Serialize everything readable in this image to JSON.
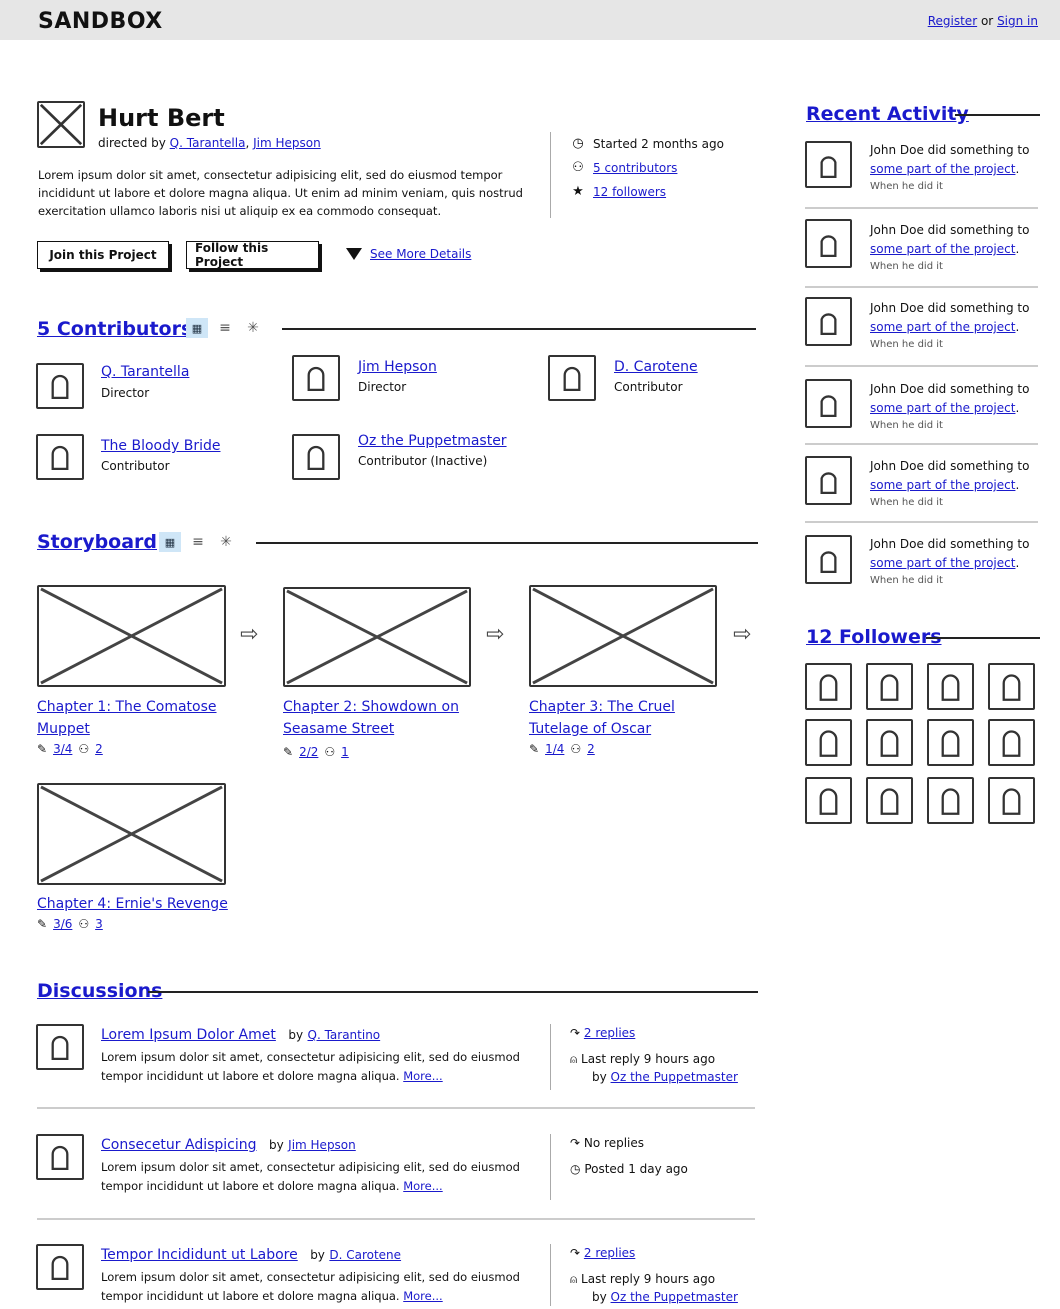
{
  "app": {
    "brand": "SANDBOX",
    "register": "Register",
    "or": "or",
    "sign_in": "Sign in"
  },
  "project": {
    "title": "Hurt Bert",
    "directed_prefix": "directed by",
    "directors": [
      "Q. Tarantella",
      "Jim Hepson"
    ],
    "description": "Lorem ipsum dolor sit amet, consectetur adipisicing elit, sed do eiusmod tempor incididunt ut labore et dolore magna aliqua. Ut enim ad minim veniam, quis nostrud exercitation ullamco laboris nisi ut aliquip ex ea commodo consequat.",
    "started": "Started 2 months ago",
    "contributors_link": "5 contributors",
    "followers_link": "12 followers",
    "join_label": "Join this Project",
    "follow_label": "Follow this Project",
    "details_label": "See More Details"
  },
  "contributors": {
    "heading": "5 Contributors",
    "people": [
      {
        "name": "Q. Tarantella",
        "role": "Director"
      },
      {
        "name": "Jim Hepson",
        "role": "Director"
      },
      {
        "name": "D. Carotene",
        "role": "Contributor"
      },
      {
        "name": "The Bloody Bride",
        "role": "Contributor"
      },
      {
        "name": "Oz the Puppetmaster",
        "role": "Contributor (Inactive)"
      }
    ]
  },
  "storyboard": {
    "heading": "Storyboard",
    "chapters": [
      {
        "title": "Chapter 1: The Comatose Muppet",
        "scenes": "3/4",
        "people": "2"
      },
      {
        "title": "Chapter 2: Showdown on Seasame Street",
        "scenes": "2/2",
        "people": "1"
      },
      {
        "title": "Chapter 3: The Cruel Tutelage of Oscar",
        "scenes": "1/4",
        "people": "2"
      },
      {
        "title": "Chapter 4: Ernie's Revenge",
        "scenes": "3/6",
        "people": "3"
      }
    ]
  },
  "discussions": {
    "heading": "Discussions",
    "items": [
      {
        "title": "Lorem Ipsum Dolor Amet",
        "by": "by",
        "author": "Q. Tarantino",
        "text": "Lorem ipsum dolor sit amet, consectetur adipisicing elit, sed do eiusmod tempor incididunt ut labore et dolore magna aliqua.",
        "more": "More...",
        "replies": "2 replies",
        "status": "Last reply 9 hours ago",
        "last_by": "by",
        "last_author": "Oz the Puppetmaster"
      },
      {
        "title": "Consecetur Adispicing",
        "by": "by",
        "author": "Jim Hepson",
        "text": "Lorem ipsum dolor sit amet, consectetur adipisicing elit, sed do eiusmod tempor incididunt ut labore et dolore magna aliqua.",
        "more": "More...",
        "replies": "No replies",
        "status": "Posted 1 day ago",
        "last_by": "",
        "last_author": ""
      },
      {
        "title": "Tempor Incididunt ut Labore",
        "by": "by",
        "author": "D. Carotene",
        "text": "Lorem ipsum dolor sit amet, consectetur adipisicing elit, sed do eiusmod tempor incididunt ut labore et dolore magna aliqua.",
        "more": "More...",
        "replies": "2 replies",
        "status": "Last reply 9 hours ago",
        "last_by": "by",
        "last_author": "Oz the Puppetmaster"
      }
    ]
  },
  "activity": {
    "heading": "Recent Activity",
    "items": [
      {
        "actor": "John Doe did something to",
        "target": "some part of the project",
        "when": "When he did it"
      },
      {
        "actor": "John Doe did something to",
        "target": "some part of the project",
        "when": "When he did it"
      },
      {
        "actor": "John Doe did something to",
        "target": "some part of the project",
        "when": "When he did it"
      },
      {
        "actor": "John Doe did something to",
        "target": "some part of the project",
        "when": "When he did it"
      },
      {
        "actor": "John Doe did something to",
        "target": "some part of the project",
        "when": "When he did it"
      },
      {
        "actor": "John Doe did something to",
        "target": "some part of the project",
        "when": "When he did it"
      }
    ]
  },
  "followers": {
    "heading": "12 Followers"
  },
  "icons": {
    "clock": "clock-icon",
    "people": "people-icon",
    "star": "star-icon",
    "grid": "grid-view-icon",
    "list": "list-view-icon",
    "burst": "spinner-icon",
    "pencil": "pencil-icon",
    "reply": "reply-icon",
    "user": "user-icon"
  }
}
